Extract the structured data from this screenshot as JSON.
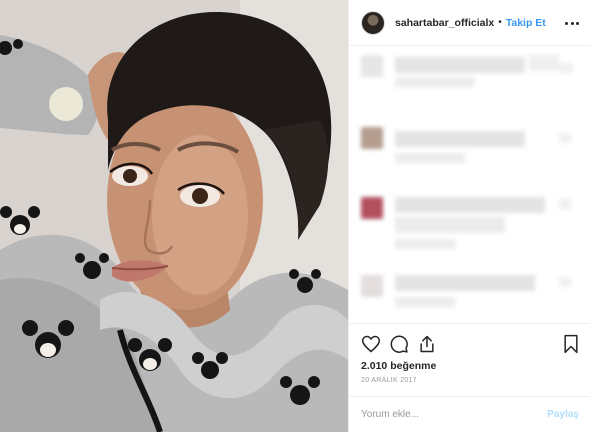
{
  "post": {
    "username": "sahartabar_officialx",
    "separator": "•",
    "follow_label": "Takip Et",
    "likes": "2.010 beğenme",
    "date": "20 ARALIK 2017"
  },
  "comment_box": {
    "placeholder": "Yorum ekle...",
    "post_label": "Paylaş"
  },
  "icons": {
    "more": "more-options-icon",
    "like": "heart-icon",
    "comment": "comment-icon",
    "share": "share-icon",
    "save": "bookmark-icon"
  },
  "colors": {
    "link_blue": "#3897f0",
    "post_disabled": "#b2dffc",
    "meta_gray": "#999999",
    "border": "#efefef"
  }
}
